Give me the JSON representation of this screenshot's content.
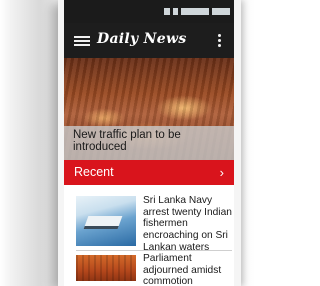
{
  "app": {
    "logo_text": "Daily News",
    "colors": {
      "app_bar": "#1d1d1d",
      "accent": "#d9141c",
      "status_bar": "#1b1b1b"
    }
  },
  "toolbar": {
    "menu_icon": "hamburger-menu-icon",
    "more_icon": "more-vertical-icon"
  },
  "hero": {
    "title": "New traffic plan to be introduced"
  },
  "section": {
    "title": "Recent",
    "chevron": "›"
  },
  "articles": [
    {
      "title": "Sri Lanka Navy arrest twenty Indian fishermen encroaching on Sri Lankan waters"
    },
    {
      "title": "Parliament adjourned amidst commotion"
    }
  ]
}
